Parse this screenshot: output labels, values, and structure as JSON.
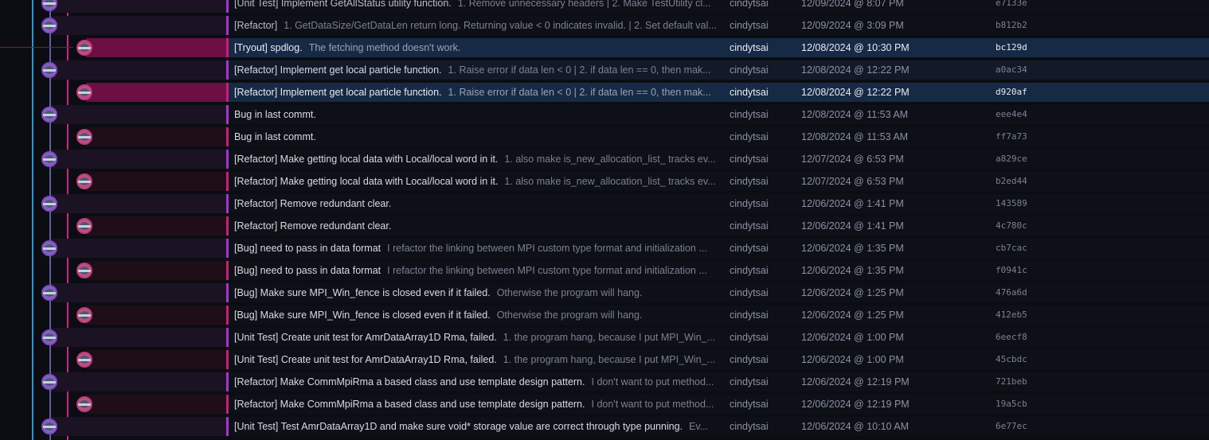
{
  "colors": {
    "rail_outer": "#1f9ad6",
    "branch_purple": "#a832d6",
    "branch_pink": "#d21a78",
    "selected_row": "#172a45"
  },
  "commits": [
    {
      "subject": "[Unit Test] Implement GetAllStatus utility function.",
      "description": "1. Remove unnecessary headers | 2. Make TestUtility cl...",
      "author": "cindytsai",
      "date": "12/09/2024 @ 8:07 PM",
      "sha": "e7133e",
      "lane": "purple",
      "state": "dim"
    },
    {
      "subject": "[Refactor]",
      "description": "1. GetDataSize/GetDataLen return long. Returning value < 0 indicates invalid. | 2. Set default val...",
      "author": "cindytsai",
      "date": "12/09/2024 @ 3:09 PM",
      "sha": "b812b2",
      "lane": "purple",
      "state": "dim"
    },
    {
      "subject": "[Tryout] spdlog.",
      "description": "The fetching method doesn't work.",
      "author": "cindytsai",
      "date": "12/08/2024 @ 10:30 PM",
      "sha": "bc129d",
      "lane": "pink",
      "state": "selected"
    },
    {
      "subject": "[Refactor] Implement get local particle function.",
      "description": "1. Raise error if data len < 0 | 2. if data len == 0, then mak...",
      "author": "cindytsai",
      "date": "12/08/2024 @ 12:22 PM",
      "sha": "a0ac34",
      "lane": "purple",
      "state": "hover"
    },
    {
      "subject": "[Refactor] Implement get local particle function.",
      "description": "1. Raise error if data len < 0 | 2. if data len == 0, then mak...",
      "author": "cindytsai",
      "date": "12/08/2024 @ 12:22 PM",
      "sha": "d920af",
      "lane": "pink",
      "state": "selected"
    },
    {
      "subject": "Bug in last commt.",
      "description": "",
      "author": "cindytsai",
      "date": "12/08/2024 @ 11:53 AM",
      "sha": "eee4e4",
      "lane": "purple",
      "state": "normal"
    },
    {
      "subject": "Bug in last commt.",
      "description": "",
      "author": "cindytsai",
      "date": "12/08/2024 @ 11:53 AM",
      "sha": "ff7a73",
      "lane": "pink",
      "state": "normal"
    },
    {
      "subject": "[Refactor] Make getting local data with Local/local word in it.",
      "description": "1. also make is_new_allocation_list_ tracks ev...",
      "author": "cindytsai",
      "date": "12/07/2024 @ 6:53 PM",
      "sha": "a829ce",
      "lane": "purple",
      "state": "normal"
    },
    {
      "subject": "[Refactor] Make getting local data with Local/local word in it.",
      "description": "1. also make is_new_allocation_list_ tracks ev...",
      "author": "cindytsai",
      "date": "12/07/2024 @ 6:53 PM",
      "sha": "b2ed44",
      "lane": "pink",
      "state": "normal"
    },
    {
      "subject": "[Refactor] Remove redundant clear.",
      "description": "",
      "author": "cindytsai",
      "date": "12/06/2024 @ 1:41 PM",
      "sha": "143589",
      "lane": "purple",
      "state": "normal"
    },
    {
      "subject": "[Refactor] Remove redundant clear.",
      "description": "",
      "author": "cindytsai",
      "date": "12/06/2024 @ 1:41 PM",
      "sha": "4c780c",
      "lane": "pink",
      "state": "normal"
    },
    {
      "subject": "[Bug] need to pass in data format",
      "description": "I refactor the linking between MPI custom type format and initialization ...",
      "author": "cindytsai",
      "date": "12/06/2024 @ 1:35 PM",
      "sha": "cb7cac",
      "lane": "purple",
      "state": "normal"
    },
    {
      "subject": "[Bug] need to pass in data format",
      "description": "I refactor the linking between MPI custom type format and initialization ...",
      "author": "cindytsai",
      "date": "12/06/2024 @ 1:35 PM",
      "sha": "f0941c",
      "lane": "pink",
      "state": "normal"
    },
    {
      "subject": "[Bug] Make sure MPI_Win_fence is closed even if it failed.",
      "description": "Otherwise the program will hang.",
      "author": "cindytsai",
      "date": "12/06/2024 @ 1:25 PM",
      "sha": "476a6d",
      "lane": "purple",
      "state": "normal"
    },
    {
      "subject": "[Bug] Make sure MPI_Win_fence is closed even if it failed.",
      "description": "Otherwise the program will hang.",
      "author": "cindytsai",
      "date": "12/06/2024 @ 1:25 PM",
      "sha": "412eb5",
      "lane": "pink",
      "state": "normal"
    },
    {
      "subject": "[Unit Test] Create unit test for AmrDataArray1D Rma, failed.",
      "description": "1. the program hang, because I put MPI_Win_...",
      "author": "cindytsai",
      "date": "12/06/2024 @ 1:00 PM",
      "sha": "6eecf8",
      "lane": "purple",
      "state": "normal"
    },
    {
      "subject": "[Unit Test] Create unit test for AmrDataArray1D Rma, failed.",
      "description": "1. the program hang, because I put MPI_Win_...",
      "author": "cindytsai",
      "date": "12/06/2024 @ 1:00 PM",
      "sha": "45cbdc",
      "lane": "pink",
      "state": "normal"
    },
    {
      "subject": "[Refactor] Make CommMpiRma a based class and use template design pattern.",
      "description": "I don't want to put method...",
      "author": "cindytsai",
      "date": "12/06/2024 @ 12:19 PM",
      "sha": "721beb",
      "lane": "purple",
      "state": "normal"
    },
    {
      "subject": "[Refactor] Make CommMpiRma a based class and use template design pattern.",
      "description": "I don't want to put method...",
      "author": "cindytsai",
      "date": "12/06/2024 @ 12:19 PM",
      "sha": "19a5cb",
      "lane": "pink",
      "state": "normal"
    },
    {
      "subject": "[Unit Test] Test AmrDataArray1D and make sure void* storage value are correct through type punning.",
      "description": "Ev...",
      "author": "cindytsai",
      "date": "12/06/2024 @ 10:10 AM",
      "sha": "6e77ec",
      "lane": "purple",
      "state": "normal"
    }
  ]
}
